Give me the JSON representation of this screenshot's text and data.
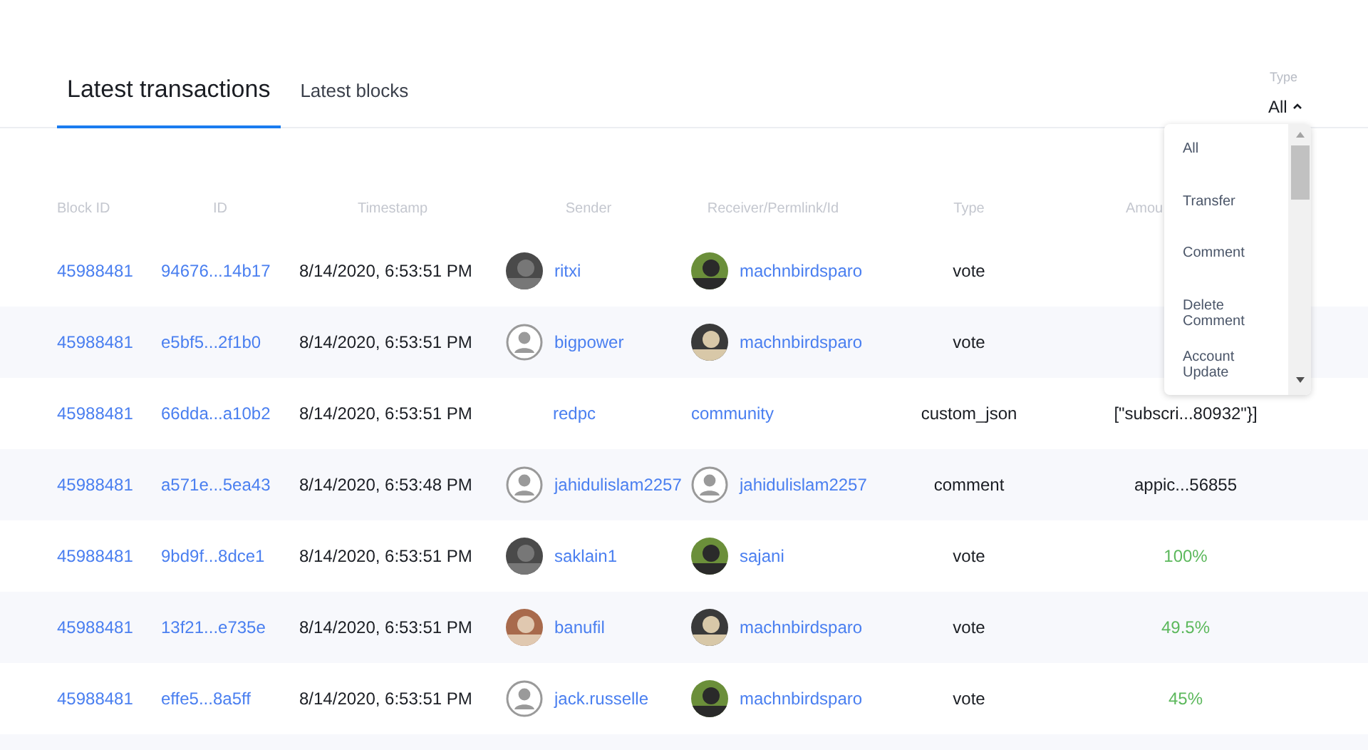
{
  "tabs": [
    {
      "label": "Latest transactions",
      "selected": true
    },
    {
      "label": "Latest blocks",
      "selected": false
    }
  ],
  "type_filter": {
    "label": "Type",
    "value": "All",
    "expanded": true,
    "options": [
      "All",
      "Transfer",
      "Comment",
      "Delete Comment",
      "Account Update"
    ]
  },
  "table": {
    "columns": [
      "Block ID",
      "ID",
      "Timestamp",
      "Sender",
      "Receiver/Permlink/Id",
      "Type",
      "Amou"
    ],
    "rows": [
      {
        "block_id": "45988481",
        "id": "94676...14b17",
        "timestamp": "8/14/2020, 6:53:51 PM",
        "sender": {
          "name": "ritxi"
        },
        "receiver": {
          "name": "machnbirdsparo"
        },
        "type": "vote"
      },
      {
        "block_id": "45988481",
        "id": "e5bf5...2f1b0",
        "timestamp": "8/14/2020, 6:53:51 PM",
        "sender": {
          "kind": "default",
          "name": "bigpower"
        },
        "receiver": {
          "name": "machnbirdsparo"
        },
        "type": "vote"
      },
      {
        "block_id": "45988481",
        "id": "66dda...a10b2",
        "timestamp": "8/14/2020, 6:53:51 PM",
        "sender": {
          "kind": "none",
          "name": "redpc"
        },
        "receiver": {
          "kind": "none",
          "name": "community"
        },
        "type": "custom_json",
        "amount": {
          "kind": "text",
          "text": "[\"subscri...80932\"}]"
        }
      },
      {
        "block_id": "45988481",
        "id": "a571e...5ea43",
        "timestamp": "8/14/2020, 6:53:48 PM",
        "sender": {
          "kind": "default",
          "name": "jahidulislam2257"
        },
        "receiver": {
          "kind": "default",
          "name": "jahidulislam2257"
        },
        "type": "comment",
        "amount": {
          "kind": "text",
          "text": "appic...56855"
        }
      },
      {
        "block_id": "45988481",
        "id": "9bd9f...8dce1",
        "timestamp": "8/14/2020, 6:53:51 PM",
        "sender": {
          "name": "saklain1"
        },
        "receiver": {
          "name": "sajani"
        },
        "type": "vote",
        "amount": {
          "kind": "percent",
          "text": "100%"
        }
      },
      {
        "block_id": "45988481",
        "id": "13f21...e735e",
        "timestamp": "8/14/2020, 6:53:51 PM",
        "sender": {
          "name": "banufil"
        },
        "receiver": {
          "name": "machnbirdsparo"
        },
        "type": "vote",
        "amount": {
          "kind": "percent",
          "text": "49.5%"
        }
      },
      {
        "block_id": "45988481",
        "id": "effe5...8a5ff",
        "timestamp": "8/14/2020, 6:53:51 PM",
        "sender": {
          "kind": "default",
          "name": "jack.russelle"
        },
        "receiver": {
          "name": "machnbirdsparo"
        },
        "type": "vote",
        "amount": {
          "kind": "percent",
          "text": "45%"
        }
      }
    ]
  }
}
